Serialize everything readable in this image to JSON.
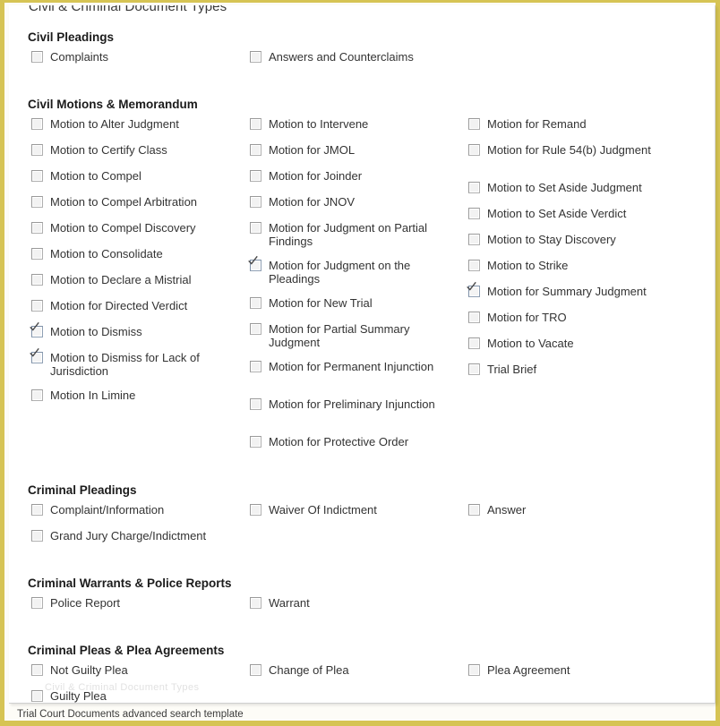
{
  "page": {
    "title": "Civil & Criminal Document Types",
    "watermark": "Civil & Criminal Document Types",
    "caption": "Trial Court Documents advanced search template",
    "accent_color": "#d6c454",
    "card_background": "#ffffff",
    "checkbox_checked_border": "#8fa0b4",
    "checkbox_unchecked_background": "#f2f2f2"
  },
  "sections": [
    {
      "id": "civil-pleadings",
      "title": "Civil Pleadings",
      "columns": [
        [
          {
            "label": "Complaints",
            "checked": false
          }
        ],
        [
          {
            "label": "Answers and Counterclaims",
            "checked": false
          }
        ],
        []
      ]
    },
    {
      "id": "civil-motions-memorandum",
      "title": "Civil Motions & Memorandum",
      "columns": [
        [
          {
            "label": "Motion to Alter Judgment",
            "checked": false
          },
          {
            "label": "Motion to Certify Class",
            "checked": false
          },
          {
            "label": "Motion to Compel",
            "checked": false
          },
          {
            "label": "Motion to Compel Arbitration",
            "checked": false
          },
          {
            "label": "Motion to Compel Discovery",
            "checked": false
          },
          {
            "label": "Motion to Consolidate",
            "checked": false
          },
          {
            "label": "Motion to Declare a Mistrial",
            "checked": false
          },
          {
            "label": "Motion for Directed Verdict",
            "checked": false
          },
          {
            "label": "Motion to Dismiss",
            "checked": true
          },
          {
            "label": "Motion to Dismiss for Lack of Jurisdiction",
            "checked": true,
            "lines": 2
          },
          {
            "label": "Motion In Limine",
            "checked": false
          }
        ],
        [
          {
            "label": "Motion to Intervene",
            "checked": false
          },
          {
            "label": "Motion for JMOL",
            "checked": false
          },
          {
            "label": "Motion for Joinder",
            "checked": false
          },
          {
            "label": "Motion for JNOV",
            "checked": false
          },
          {
            "label": "Motion for Judgment on Partial Findings",
            "checked": false,
            "lines": 2
          },
          {
            "label": "Motion for Judgment on the Pleadings",
            "checked": true,
            "lines": 2
          },
          {
            "label": "Motion for New Trial",
            "checked": false
          },
          {
            "label": "Motion for Partial Summary Judgment",
            "checked": false,
            "lines": 2
          },
          {
            "label": "Motion for Permanent Injunction",
            "checked": false,
            "lines": 2
          },
          {
            "label": "Motion for Preliminary Injunction",
            "checked": false,
            "lines": 2
          },
          {
            "label": "Motion for Protective Order",
            "checked": false
          }
        ],
        [
          {
            "label": "Motion for Remand",
            "checked": false
          },
          {
            "label": "Motion for Rule 54(b) Judgment",
            "checked": false,
            "lines": 2
          },
          {
            "label": "Motion to Set Aside Judgment",
            "checked": false
          },
          {
            "label": "Motion to Set Aside Verdict",
            "checked": false
          },
          {
            "label": "Motion to Stay Discovery",
            "checked": false
          },
          {
            "label": "Motion to Strike",
            "checked": false
          },
          {
            "label": "Motion for Summary Judgment",
            "checked": true
          },
          {
            "label": "Motion for TRO",
            "checked": false
          },
          {
            "label": "Motion to Vacate",
            "checked": false
          },
          {
            "label": "Trial Brief",
            "checked": false
          }
        ]
      ]
    },
    {
      "id": "criminal-pleadings",
      "title": "Criminal Pleadings",
      "columns": [
        [
          {
            "label": "Complaint/Information",
            "checked": false
          },
          {
            "label": "Grand Jury Charge/Indictment",
            "checked": false
          }
        ],
        [
          {
            "label": "Waiver Of Indictment",
            "checked": false
          }
        ],
        [
          {
            "label": "Answer",
            "checked": false
          }
        ]
      ]
    },
    {
      "id": "criminal-warrants-police-reports",
      "title": "Criminal Warrants & Police Reports",
      "columns": [
        [
          {
            "label": "Police Report",
            "checked": false
          }
        ],
        [
          {
            "label": "Warrant",
            "checked": false
          }
        ],
        []
      ]
    },
    {
      "id": "criminal-pleas-plea-agreements",
      "title": "Criminal Pleas & Plea Agreements",
      "columns": [
        [
          {
            "label": "Not Guilty Plea",
            "checked": false
          },
          {
            "label": "Guilty Plea",
            "checked": false
          }
        ],
        [
          {
            "label": "Change of Plea",
            "checked": false
          }
        ],
        [
          {
            "label": "Plea Agreement",
            "checked": false
          }
        ]
      ]
    }
  ],
  "section_offsets": [
    28,
    103,
    534,
    638,
    713
  ]
}
